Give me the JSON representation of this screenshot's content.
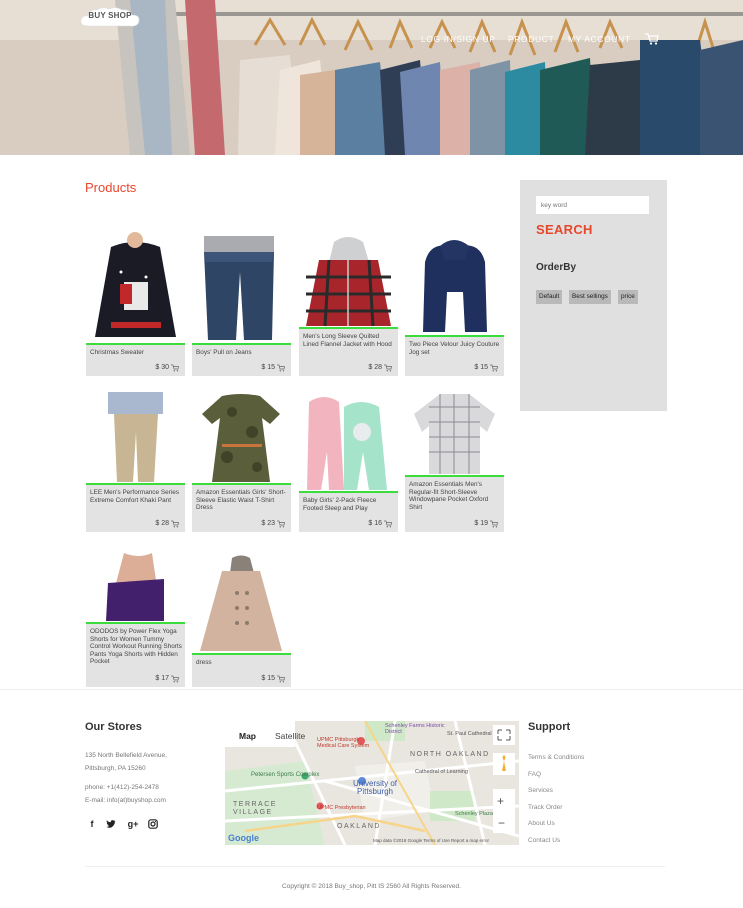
{
  "brand": {
    "logo_text": "BUY SHOP"
  },
  "nav": {
    "items": [
      "LOG IN/SIGN UP",
      "PRODUCT",
      "MY ACCOUNT"
    ]
  },
  "products": {
    "title": "Products",
    "items": [
      {
        "name": "Christmas Sweater",
        "price": "$ 30"
      },
      {
        "name": "Boys' Pull on Jeans",
        "price": "$ 15"
      },
      {
        "name": "Men's Long Sleeve Quilted Lined Flannel Jacket with Hood",
        "price": "$ 28"
      },
      {
        "name": "Two Piece Velour Juicy Couture Jog set",
        "price": "$ 15"
      },
      {
        "name": "LEE Men's Performance Series Extreme Comfort Khaki Pant",
        "price": "$ 28"
      },
      {
        "name": "Amazon Essentials Girls' Short-Sleeve Elastic Waist T-Shirt Dress",
        "price": "$ 23"
      },
      {
        "name": "Baby Girls' 2-Pack Fleece Footed Sleep and Play",
        "price": "$ 16"
      },
      {
        "name": "Amazon Essentials Men's Regular-fit Short-Sleeve Windowpane Pocket Oxford Shirt",
        "price": "$ 19"
      },
      {
        "name": "ODODOS by Power Flex Yoga Shorts for Women Tummy Control Workout Running Shorts Pants Yoga Shorts with Hidden Pocket",
        "price": "$ 17"
      },
      {
        "name": "dress",
        "price": "$ 15"
      }
    ]
  },
  "sidebar": {
    "search_placeholder": "key word",
    "search_label": "SEARCH",
    "orderby_label": "OrderBy",
    "sort_options": [
      "Default",
      "Best sellings",
      "price"
    ]
  },
  "footer": {
    "stores_title": "Our Stores",
    "address_line1": "135 North Bellefield Avenue,",
    "address_line2": "Pittsburgh, PA 15260",
    "phone": "phone: +1(412)-254-2478",
    "email": "E-mail:  info(at)buyshop.com",
    "social": [
      "f",
      "t",
      "g+",
      "ig"
    ],
    "map": {
      "tab_map": "Map",
      "tab_satellite": "Satellite",
      "labels": [
        "Schenley Farms Historic District",
        "St. Paul Cathedral",
        "UPMC Pittsburgh Medical Care System",
        "NORTH OAKLAND",
        "Petersen Sports Complex",
        "University of Pittsburgh",
        "Cathedral of Learning",
        "TERRACE VILLAGE",
        "UPMC Presbyterian",
        "OAKLAND",
        "Schenley Plaza"
      ],
      "brand": "Google",
      "credits": "Map data ©2018 Google   Terms of Use   Report a map error"
    },
    "support_title": "Support",
    "support_links": [
      "Terms & Conditions",
      "FAQ",
      "Services",
      "Track Order",
      "About Us",
      "Contact Us"
    ],
    "copyright": "Copyright © 2018 Buy_shop, Pitt IS 2560 All Rights Reserved."
  },
  "colors": {
    "accent": "#e8472c",
    "card_bar": "#3ddc3d",
    "card_bg": "#e3e3e3",
    "sidebar_bg": "#e0e0e0"
  }
}
